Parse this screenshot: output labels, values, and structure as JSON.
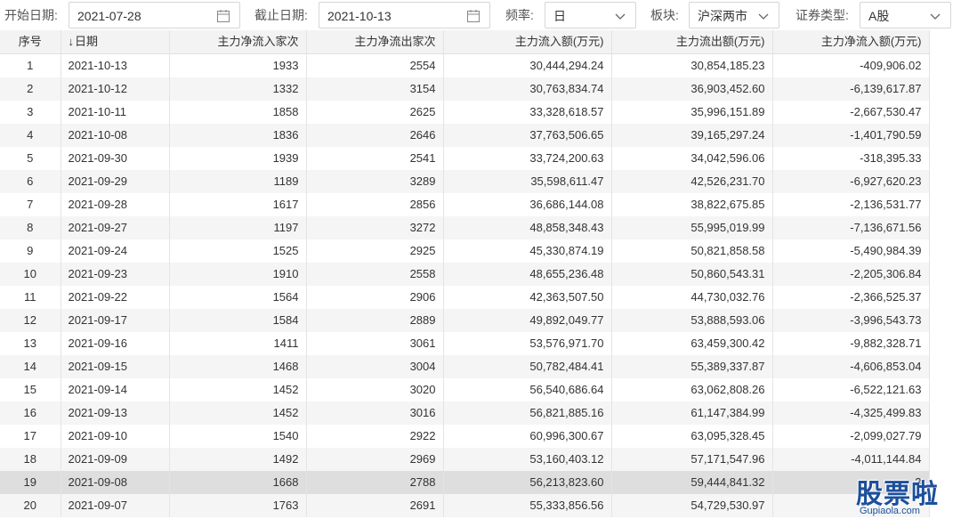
{
  "filters": {
    "start_label": "开始日期:",
    "start_value": "2021-07-28",
    "end_label": "截止日期:",
    "end_value": "2021-10-13",
    "freq_label": "频率:",
    "freq_value": "日",
    "sector_label": "板块:",
    "sector_value": "沪深两市",
    "sectype_label": "证券类型:",
    "sectype_value": "A股"
  },
  "table": {
    "headers": [
      "序号",
      "日期",
      "主力净流入家次",
      "主力净流出家次",
      "主力流入额(万元)",
      "主力流出额(万元)",
      "主力净流入额(万元)"
    ],
    "sort_indicator": "↓",
    "rows": [
      [
        "1",
        "2021-10-13",
        "1933",
        "2554",
        "30,444,294.24",
        "30,854,185.23",
        "-409,906.02"
      ],
      [
        "2",
        "2021-10-12",
        "1332",
        "3154",
        "30,763,834.74",
        "36,903,452.60",
        "-6,139,617.87"
      ],
      [
        "3",
        "2021-10-11",
        "1858",
        "2625",
        "33,328,618.57",
        "35,996,151.89",
        "-2,667,530.47"
      ],
      [
        "4",
        "2021-10-08",
        "1836",
        "2646",
        "37,763,506.65",
        "39,165,297.24",
        "-1,401,790.59"
      ],
      [
        "5",
        "2021-09-30",
        "1939",
        "2541",
        "33,724,200.63",
        "34,042,596.06",
        "-318,395.33"
      ],
      [
        "6",
        "2021-09-29",
        "1189",
        "3289",
        "35,598,611.47",
        "42,526,231.70",
        "-6,927,620.23"
      ],
      [
        "7",
        "2021-09-28",
        "1617",
        "2856",
        "36,686,144.08",
        "38,822,675.85",
        "-2,136,531.77"
      ],
      [
        "8",
        "2021-09-27",
        "1197",
        "3272",
        "48,858,348.43",
        "55,995,019.99",
        "-7,136,671.56"
      ],
      [
        "9",
        "2021-09-24",
        "1525",
        "2925",
        "45,330,874.19",
        "50,821,858.58",
        "-5,490,984.39"
      ],
      [
        "10",
        "2021-09-23",
        "1910",
        "2558",
        "48,655,236.48",
        "50,860,543.31",
        "-2,205,306.84"
      ],
      [
        "11",
        "2021-09-22",
        "1564",
        "2906",
        "42,363,507.50",
        "44,730,032.76",
        "-2,366,525.37"
      ],
      [
        "12",
        "2021-09-17",
        "1584",
        "2889",
        "49,892,049.77",
        "53,888,593.06",
        "-3,996,543.73"
      ],
      [
        "13",
        "2021-09-16",
        "1411",
        "3061",
        "53,576,971.70",
        "63,459,300.42",
        "-9,882,328.71"
      ],
      [
        "14",
        "2021-09-15",
        "1468",
        "3004",
        "50,782,484.41",
        "55,389,337.87",
        "-4,606,853.04"
      ],
      [
        "15",
        "2021-09-14",
        "1452",
        "3020",
        "56,540,686.64",
        "63,062,808.26",
        "-6,522,121.63"
      ],
      [
        "16",
        "2021-09-13",
        "1452",
        "3016",
        "56,821,885.16",
        "61,147,384.99",
        "-4,325,499.83"
      ],
      [
        "17",
        "2021-09-10",
        "1540",
        "2922",
        "60,996,300.67",
        "63,095,328.45",
        "-2,099,027.79"
      ],
      [
        "18",
        "2021-09-09",
        "1492",
        "2969",
        "53,160,403.12",
        "57,171,547.96",
        "-4,011,144.84"
      ],
      [
        "19",
        "2021-09-08",
        "1668",
        "2788",
        "56,213,823.60",
        "59,444,841.32",
        "-3"
      ],
      [
        "20",
        "2021-09-07",
        "1763",
        "2691",
        "55,333,856.56",
        "54,729,530.97",
        ""
      ]
    ],
    "selected_row": "19"
  },
  "watermark": {
    "text": "股票啦",
    "url": "Gupiaola.com"
  },
  "colors": {
    "header_bg": "#f3f3f3",
    "stripe_bg": "#f5f5f5",
    "selected_bg": "#dedede",
    "border": "#d6d6d6"
  },
  "icons": [
    "calendar-icon",
    "chevron-down-icon"
  ]
}
